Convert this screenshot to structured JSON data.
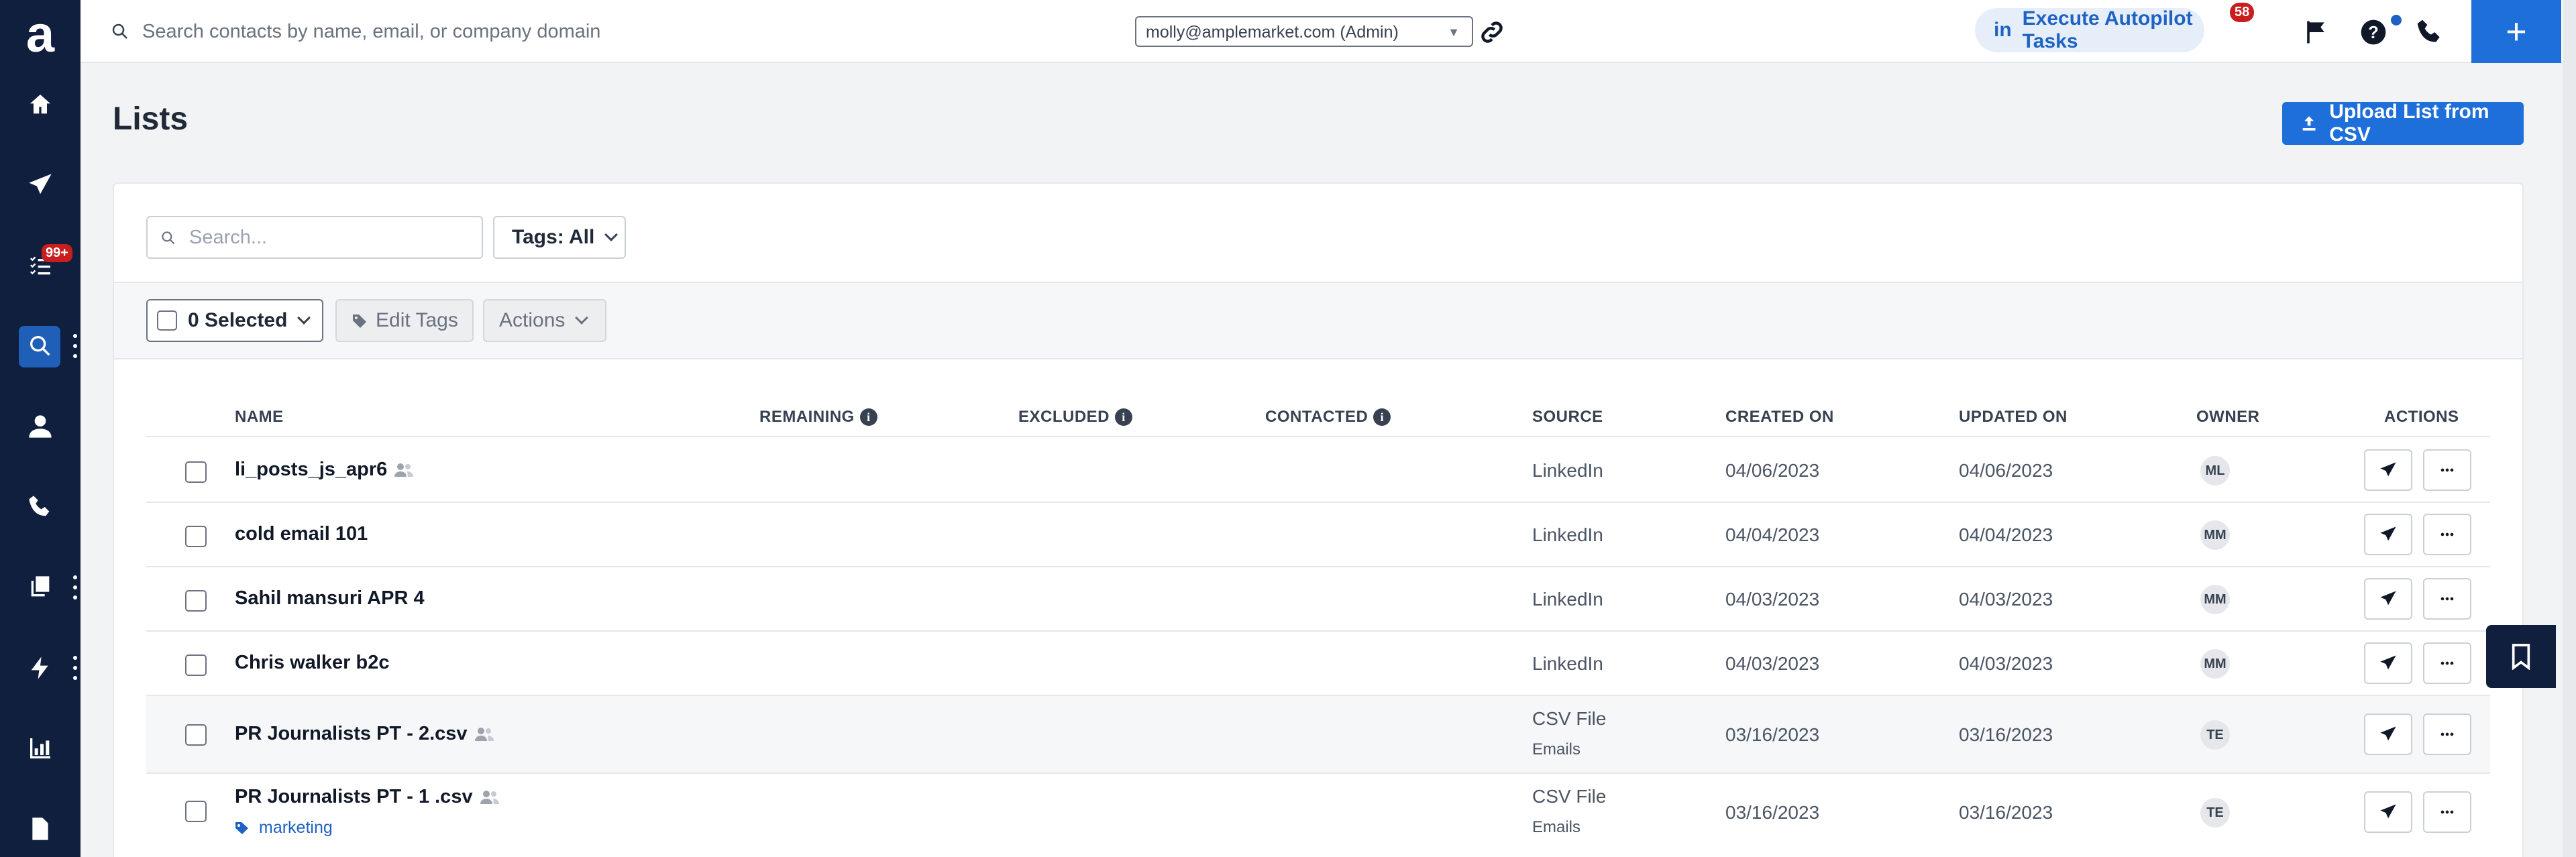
{
  "top_bar": {
    "search_placeholder": "Search contacts by name, email, or company domain",
    "account": "molly@amplemarket.com (Admin)",
    "autopilot_label": "Execute Autopilot Tasks",
    "autopilot_prefix": "in",
    "autopilot_count": "58"
  },
  "sidebar": {
    "logo": "a",
    "tasks_badge": "99+"
  },
  "page": {
    "title": "Lists",
    "upload_label": "Upload List from CSV"
  },
  "filters": {
    "search_placeholder": "Search...",
    "tags_label": "Tags: All"
  },
  "toolbar": {
    "selected_label": "0 Selected",
    "edit_tags_label": "Edit Tags",
    "actions_label": "Actions"
  },
  "table": {
    "headers": {
      "name": "NAME",
      "remaining": "REMAINING",
      "excluded": "EXCLUDED",
      "contacted": "CONTACTED",
      "source": "SOURCE",
      "created": "CREATED ON",
      "updated": "UPDATED ON",
      "owner": "OWNER",
      "actions": "ACTIONS"
    },
    "rows": [
      {
        "name": "li_posts_js_apr6",
        "shared": true,
        "source": "LinkedIn",
        "source_sub": "",
        "created": "04/06/2023",
        "updated": "04/06/2023",
        "owner": "ML",
        "tag": ""
      },
      {
        "name": "cold email 101",
        "shared": false,
        "source": "LinkedIn",
        "source_sub": "",
        "created": "04/04/2023",
        "updated": "04/04/2023",
        "owner": "MM",
        "tag": ""
      },
      {
        "name": "Sahil mansuri APR 4",
        "shared": false,
        "source": "LinkedIn",
        "source_sub": "",
        "created": "04/03/2023",
        "updated": "04/03/2023",
        "owner": "MM",
        "tag": ""
      },
      {
        "name": "Chris walker b2c",
        "shared": false,
        "source": "LinkedIn",
        "source_sub": "",
        "created": "04/03/2023",
        "updated": "04/03/2023",
        "owner": "MM",
        "tag": ""
      },
      {
        "name": "PR Journalists PT - 2.csv",
        "shared": true,
        "source": "CSV File",
        "source_sub": "Emails",
        "created": "03/16/2023",
        "updated": "03/16/2023",
        "owner": "TE",
        "tag": ""
      },
      {
        "name": "PR Journalists PT - 1 .csv",
        "shared": true,
        "source": "CSV File",
        "source_sub": "Emails",
        "created": "03/16/2023",
        "updated": "03/16/2023",
        "owner": "TE",
        "tag": "marketing"
      }
    ]
  },
  "colors": {
    "brand_blue": "#1e6fd9",
    "sidebar_bg": "#0f1f3d",
    "badge_red": "#c81e1e"
  }
}
